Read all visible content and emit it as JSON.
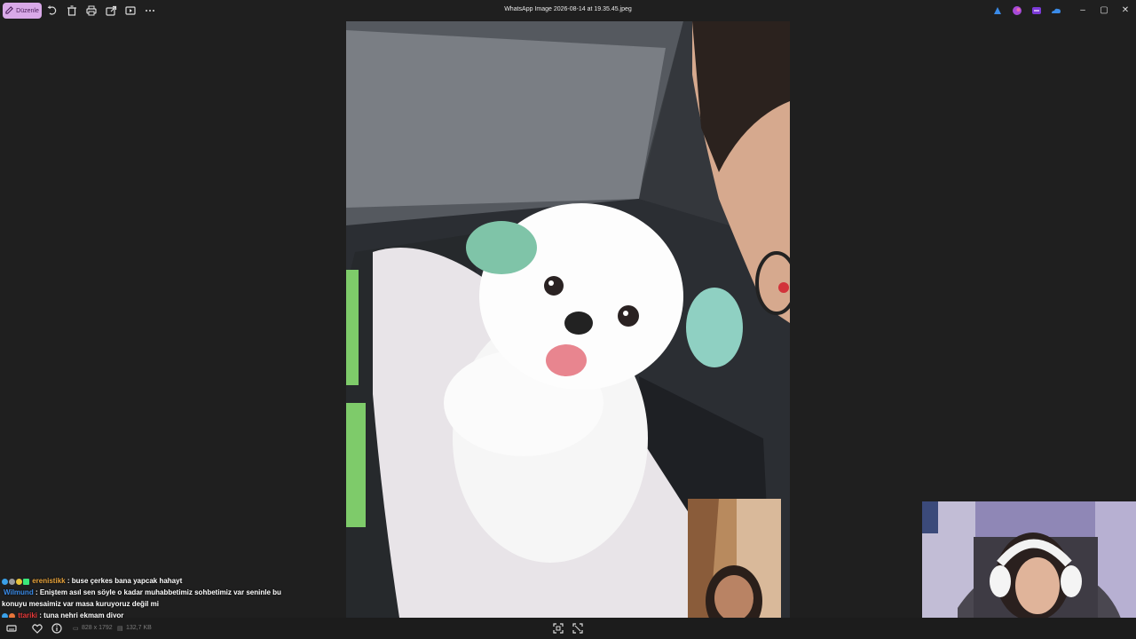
{
  "toolbar": {
    "edit_label": "Düzenle",
    "icons": [
      "rotate-icon",
      "delete-icon",
      "print-icon",
      "share-icon",
      "slideshow-icon",
      "more-icon"
    ]
  },
  "window": {
    "title": "WhatsApp Image 2026-08-14 at 19.35.45.jpeg",
    "minimize": "–",
    "maximize": "▢",
    "close": "✕"
  },
  "tray_icons": [
    "copilot-icon",
    "designer-icon",
    "clipchamp-icon",
    "onedrive-icon"
  ],
  "image_info": {
    "dimensions": "828 x 1792",
    "file_size": "132,7 KB"
  },
  "chat": [
    {
      "user": "erenistikk",
      "user_color": "#e8a33a",
      "badges": [
        "#3aa0e8",
        "#9b9b9b",
        "#e8c23a",
        "#3ae87a"
      ],
      "message": ": buse çerkes bana yapcak hahayt"
    },
    {
      "user": "Wilmund",
      "user_color": "#3a8be8",
      "badges": [],
      "message": ": Eniştem asıl sen söyle o kadar muhabbetimiz sohbetimiz var seninle bu",
      "message_cont": "konuyu mesaimiz var masa kuruyoruz değil mi"
    },
    {
      "user": "ttariki",
      "user_color": "#e83a3a",
      "badges": [
        "#3aa0e8",
        "#e8753a"
      ],
      "message": ": tuna nehri ekmam diyor"
    }
  ],
  "colors": {
    "background": "#1f1f1f",
    "edit_button": "#d9a9e8",
    "text": "#e6e6e6"
  }
}
